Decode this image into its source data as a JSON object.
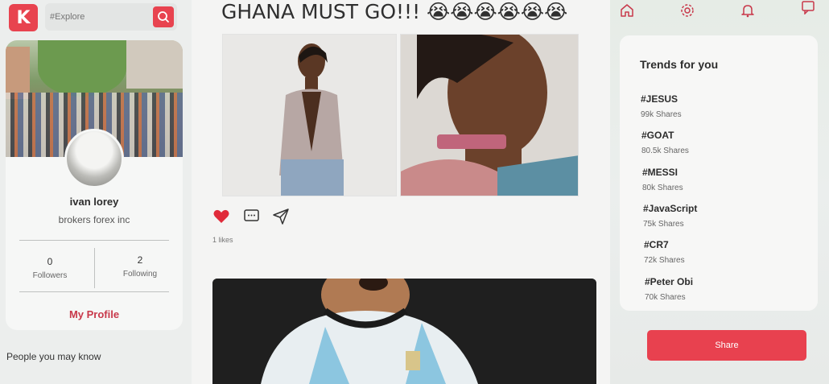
{
  "app": {
    "logo_letter": "K"
  },
  "search": {
    "placeholder": "#Explore"
  },
  "profile": {
    "name": "ivan lorey",
    "company": "brokers forex inc",
    "followers_count": "0",
    "followers_label": "Followers",
    "following_count": "2",
    "following_label": "Following",
    "my_profile_label": "My Profile"
  },
  "people_section": {
    "heading": "People you may know"
  },
  "post": {
    "title": "GHANA MUST GO!!! 😭😭😭😭😭😭",
    "likes_text": "1 likes"
  },
  "trends": {
    "title": "Trends for you",
    "items": [
      {
        "tag": "#JESUS",
        "shares": "99k Shares"
      },
      {
        "tag": "#GOAT",
        "shares": "80.5k Shares"
      },
      {
        "tag": "#MESSI",
        "shares": "80k Shares"
      },
      {
        "tag": "#JavaScript",
        "shares": "75k Shares"
      },
      {
        "tag": "#CR7",
        "shares": "72k Shares"
      },
      {
        "tag": "#Peter Obi",
        "shares": "70k Shares"
      }
    ]
  },
  "share_button": {
    "label": "Share"
  },
  "colors": {
    "accent": "#e8434f",
    "like": "#e02b3a"
  }
}
